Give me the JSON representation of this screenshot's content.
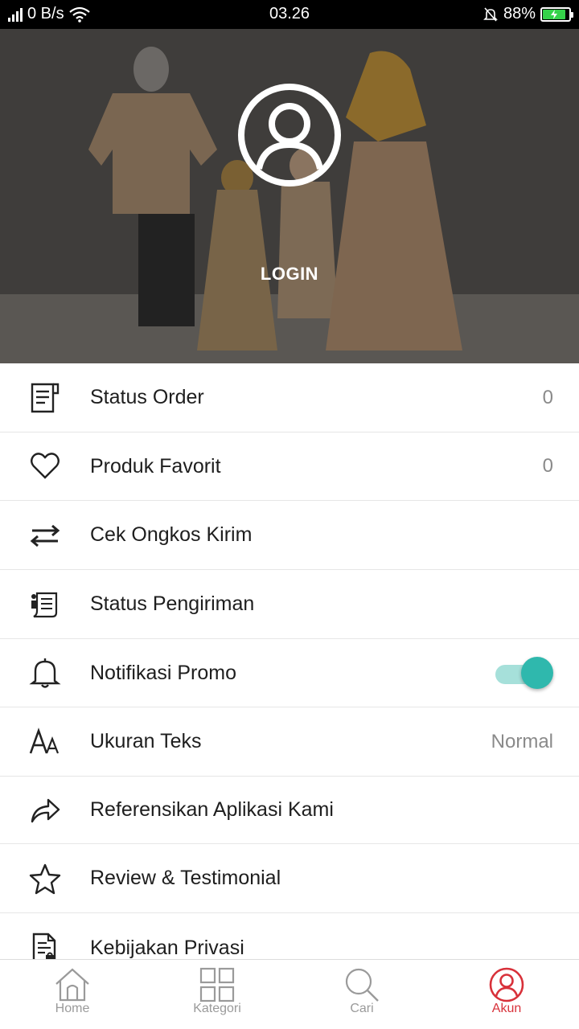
{
  "status_bar": {
    "network_speed": "0 B/s",
    "time": "03.26",
    "battery": "88%",
    "battery_level": 0.88,
    "icons": [
      "signal-icon",
      "wifi-icon",
      "alarm-off-icon",
      "battery-charging-icon"
    ]
  },
  "header": {
    "login_label": "LOGIN",
    "avatar_icon": "user-circle-icon"
  },
  "menu": {
    "items": [
      {
        "label": "Status Order",
        "value": "0",
        "icon": "order-list-icon"
      },
      {
        "label": "Produk Favorit",
        "value": "0",
        "icon": "heart-icon"
      },
      {
        "label": "Cek Ongkos Kirim",
        "icon": "swap-arrows-icon"
      },
      {
        "label": "Status Pengiriman",
        "icon": "shipping-document-icon"
      },
      {
        "label": "Notifikasi Promo",
        "icon": "bell-icon",
        "toggle_on": true
      },
      {
        "label": "Ukuran Teks",
        "value": "Normal",
        "icon": "text-size-icon"
      },
      {
        "label": "Referensikan Aplikasi Kami",
        "icon": "share-arrow-icon"
      },
      {
        "label": "Review & Testimonial",
        "icon": "star-icon"
      },
      {
        "label": "Kebijakan Privasi",
        "icon": "privacy-document-icon"
      }
    ]
  },
  "bottom_nav": {
    "items": [
      {
        "label": "Home",
        "icon": "home-icon",
        "active": false
      },
      {
        "label": "Kategori",
        "icon": "grid-icon",
        "active": false
      },
      {
        "label": "Cari",
        "icon": "search-icon",
        "active": false
      },
      {
        "label": "Akun",
        "icon": "account-icon",
        "active": true
      }
    ]
  },
  "colors": {
    "accent": "#d8313a",
    "toggle_on": "#2fb8ad",
    "toggle_track": "#a6e0da",
    "muted_text": "#8a8a8a"
  }
}
